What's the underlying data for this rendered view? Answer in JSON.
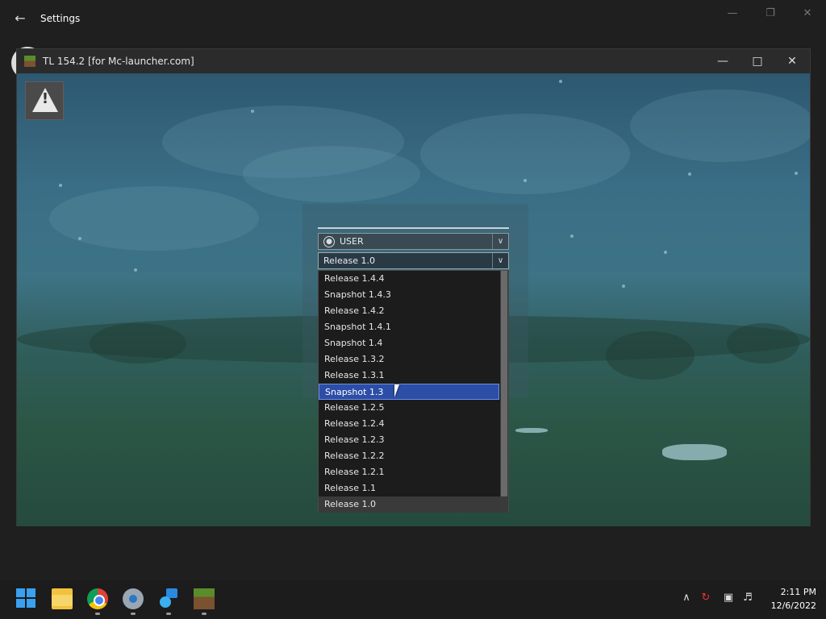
{
  "settings": {
    "title": "Settings",
    "back_icon": "back-arrow-icon"
  },
  "launcher": {
    "title": "TL 154.2 [for Mc-launcher.com]",
    "warning_icon": "warning-icon",
    "account": {
      "icon": "user-circle-icon",
      "value": "USER"
    },
    "version": {
      "value": "Release 1.0",
      "options": [
        "Release 1.4.4",
        "Snapshot 1.4.3",
        "Release 1.4.2",
        "Snapshot 1.4.1",
        "Snapshot 1.4",
        "Release 1.3.2",
        "Release 1.3.1",
        "Snapshot 1.3",
        "Release 1.2.5",
        "Release 1.2.4",
        "Release 1.2.3",
        "Release 1.2.2",
        "Release 1.2.1",
        "Release 1.1",
        "Release 1.0"
      ],
      "highlighted": "Snapshot 1.3"
    }
  },
  "taskbar": {
    "apps": [
      "start-icon",
      "file-explorer-icon",
      "chrome-icon",
      "settings-gear-icon",
      "people-icon",
      "minecraft-launcher-icon"
    ],
    "tray": [
      "chevron-up-icon",
      "sync-icon",
      "network-icon",
      "volume-icon"
    ],
    "time": "2:11 PM",
    "date": "12/6/2022"
  },
  "colors": {
    "selection": "#2c4ea6",
    "taskbar": "#1c1c1c"
  }
}
